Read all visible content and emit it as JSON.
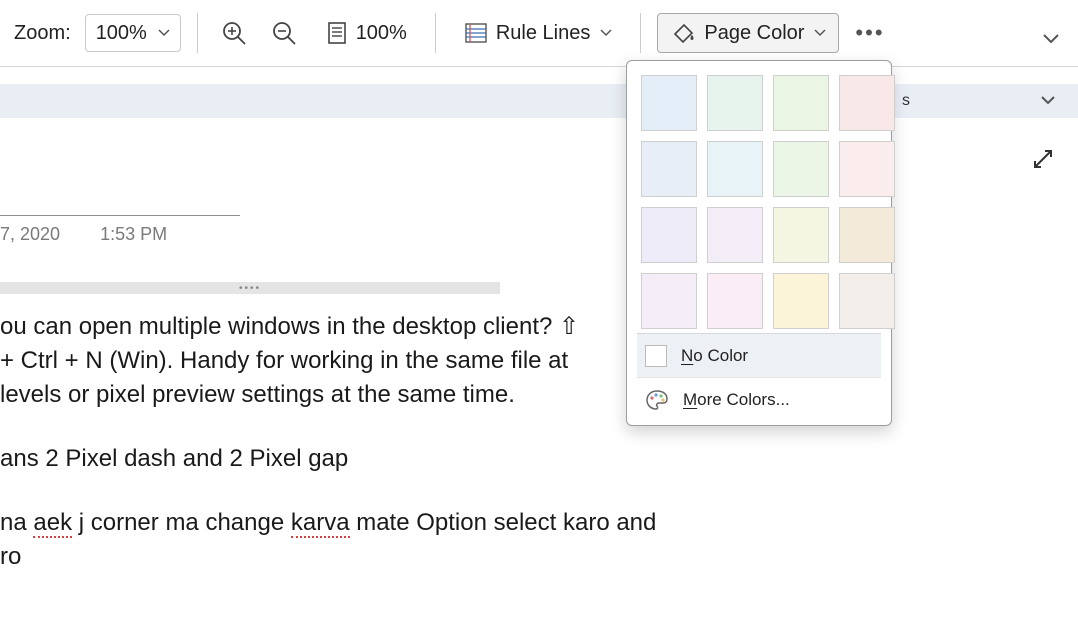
{
  "toolbar": {
    "zoom_label": "Zoom:",
    "zoom_value": "100%",
    "page_width_value": "100%",
    "rule_lines_label": "Rule Lines",
    "page_color_label": "Page Color"
  },
  "subbar": {
    "right_text_fragment": "s"
  },
  "meta": {
    "date_fragment": "7, 2020",
    "time": "1:53 PM"
  },
  "body": {
    "p1_l1": "ou can open multiple windows in the desktop client? ⇧",
    "p1_l2": "+ Ctrl + N (Win). Handy for working in the same file at",
    "p1_l3": " levels or pixel preview settings at the same time.",
    "p2": "ans 2 Pixel dash and 2 Pixel gap",
    "p3_pre": "na ",
    "p3_sq1": "aek",
    "p3_mid1": " j corner ma change ",
    "p3_sq2": "karva",
    "p3_mid2": " mate Option select karo and",
    "p3_l2": "ro"
  },
  "popup": {
    "swatches": [
      "#E3EEF8",
      "#E7F4ED",
      "#EAF5E3",
      "#F9E8E8",
      "#E7EEF8",
      "#E7F3F6",
      "#ECF6E6",
      "#FBEDED",
      "#EEECF8",
      "#F3EDF7",
      "#F4F6E2",
      "#F4EAD9",
      "#F4ECF6",
      "#FBEDF5",
      "#FCF4D9",
      "#F3EEEA"
    ],
    "no_color_pre": "N",
    "no_color_rest": "o Color",
    "more_colors_pre": "M",
    "more_colors_rest": "ore Colors..."
  }
}
